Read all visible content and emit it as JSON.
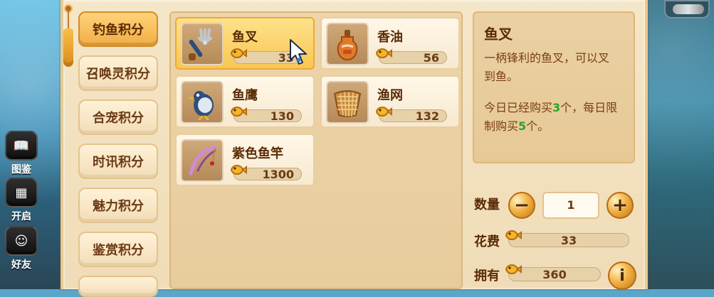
{
  "left_shortcuts": [
    {
      "name": "图鉴"
    },
    {
      "name": "开启"
    },
    {
      "name": "好友"
    }
  ],
  "tabs": [
    {
      "label": "钓鱼积分",
      "active": true
    },
    {
      "label": "召唤灵积分",
      "active": false
    },
    {
      "label": "合宠积分",
      "active": false
    },
    {
      "label": "时讯积分",
      "active": false
    },
    {
      "label": "魅力积分",
      "active": false
    },
    {
      "label": "鉴赏积分",
      "active": false
    }
  ],
  "items": [
    {
      "name": "鱼叉",
      "price": "33",
      "icon": "fork-icon",
      "selected": true
    },
    {
      "name": "香油",
      "price": "56",
      "icon": "oil-bottle-icon",
      "selected": false
    },
    {
      "name": "鱼鹰",
      "price": "130",
      "icon": "bird-icon",
      "selected": false
    },
    {
      "name": "渔网",
      "price": "132",
      "icon": "net-icon",
      "selected": false
    },
    {
      "name": "紫色鱼竿",
      "price": "1300",
      "icon": "fishing-rod-icon",
      "selected": false
    }
  ],
  "details": {
    "title": "鱼叉",
    "line1": "一柄锋利的鱼叉，可以叉",
    "line2": "到鱼。",
    "limit_prefix": "今日已经购买",
    "limit_bought": "3",
    "limit_mid": "个，每日限",
    "limit_mid2": "制购买",
    "limit_max": "5",
    "limit_suffix": "个。"
  },
  "purchase": {
    "quantity_label": "数量",
    "quantity_value": "1",
    "minus_label": "−",
    "plus_label": "+",
    "cost_label": "花费",
    "cost_value": "33",
    "owned_label": "拥有",
    "owned_value": "360",
    "info_label": "i"
  },
  "colors": {
    "accent": "#f0ad44",
    "highlight_green": "#2aa52a"
  }
}
